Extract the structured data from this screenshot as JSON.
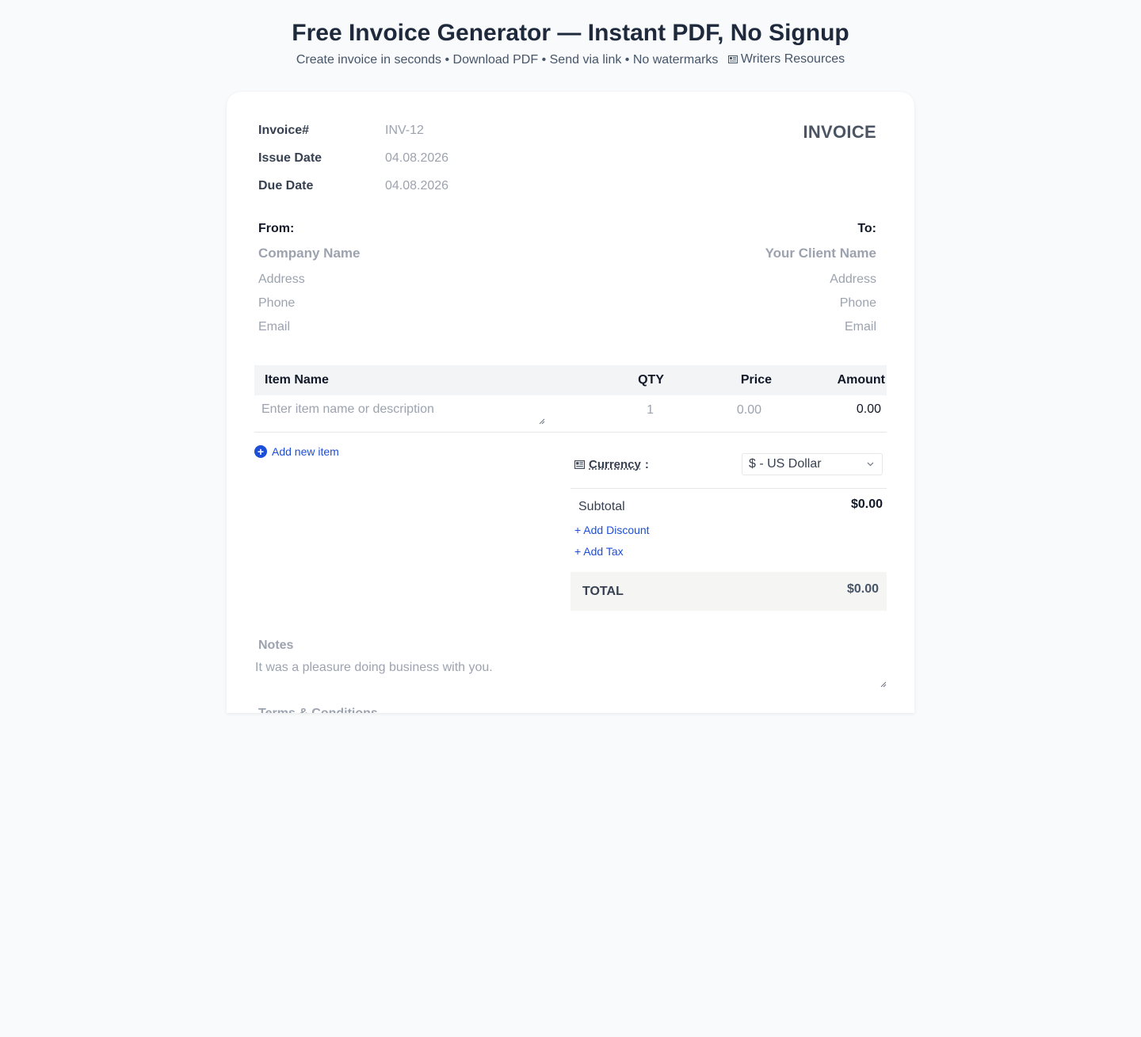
{
  "header": {
    "title": "Free Invoice Generator — Instant PDF, No Signup",
    "subtitle": "Create invoice in seconds • Download PDF • Send via link • No watermarks",
    "resources_link": "Writers Resources"
  },
  "invoice": {
    "heading": "INVOICE",
    "number_label": "Invoice#",
    "number_value": "INV-12",
    "issue_label": "Issue Date",
    "issue_value": "04.08.2026",
    "due_label": "Due Date",
    "due_value": "04.08.2026"
  },
  "from": {
    "label": "From:",
    "name_placeholder": "Company Name",
    "address_placeholder": "Address",
    "phone_placeholder": "Phone",
    "email_placeholder": "Email"
  },
  "to": {
    "label": "To:",
    "name_placeholder": "Your Client Name",
    "address_placeholder": "Address",
    "phone_placeholder": "Phone",
    "email_placeholder": "Email"
  },
  "items": {
    "headers": [
      "Item Name",
      "QTY",
      "Price",
      "Amount"
    ],
    "rows": [
      {
        "name_placeholder": "Enter item name or description",
        "qty": "1",
        "price": "0.00",
        "amount": "0.00"
      }
    ],
    "add_label": "Add new item"
  },
  "totals": {
    "currency_label": "Currency",
    "currency_colon": ":",
    "currency_value": "$ - US Dollar",
    "subtotal_label": "Subtotal",
    "subtotal_value": "$0.00",
    "add_discount": "+ Add Discount",
    "add_tax": "+ Add Tax",
    "total_label": "TOTAL",
    "total_value": "$0.00"
  },
  "notes": {
    "label": "Notes",
    "value": "It was a pleasure doing business with you."
  },
  "terms": {
    "label": "Terms & Conditions"
  },
  "colors": {
    "accent": "#1d4ed8",
    "background": "#f8fafc",
    "card": "#ffffff"
  }
}
